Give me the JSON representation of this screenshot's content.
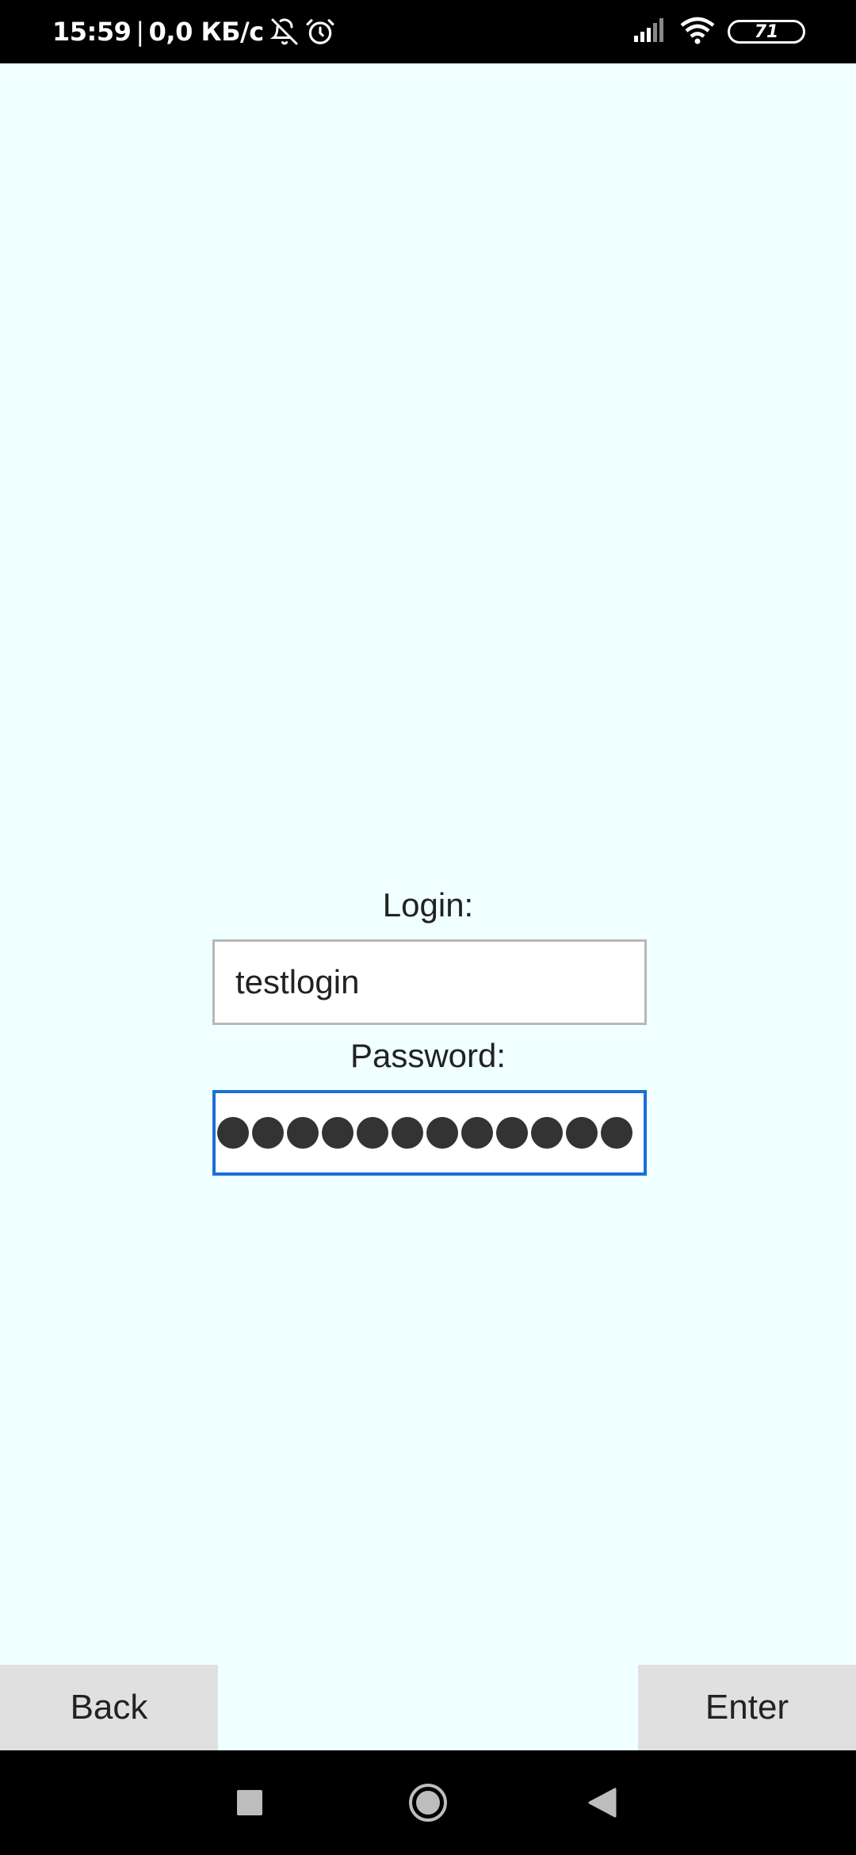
{
  "status_bar": {
    "time": "15:59",
    "separator": "|",
    "network_speed": "0,0 КБ/с",
    "icons": [
      "bell-off-icon",
      "alarm-icon",
      "signal-icon",
      "wifi-icon",
      "battery-icon"
    ],
    "battery_level": "71"
  },
  "form": {
    "login_label": "Login:",
    "login_value": "testlogin",
    "password_label": "Password:",
    "password_mask_count": 12
  },
  "buttons": {
    "back_label": "Back",
    "enter_label": "Enter"
  },
  "nav_bar": {
    "icons": [
      "recents-square-icon",
      "home-circle-icon",
      "back-triangle-icon"
    ]
  },
  "colors": {
    "background": "#f0ffff",
    "focus_border": "#1a6fd6",
    "button_bg": "#e0e0e0"
  }
}
